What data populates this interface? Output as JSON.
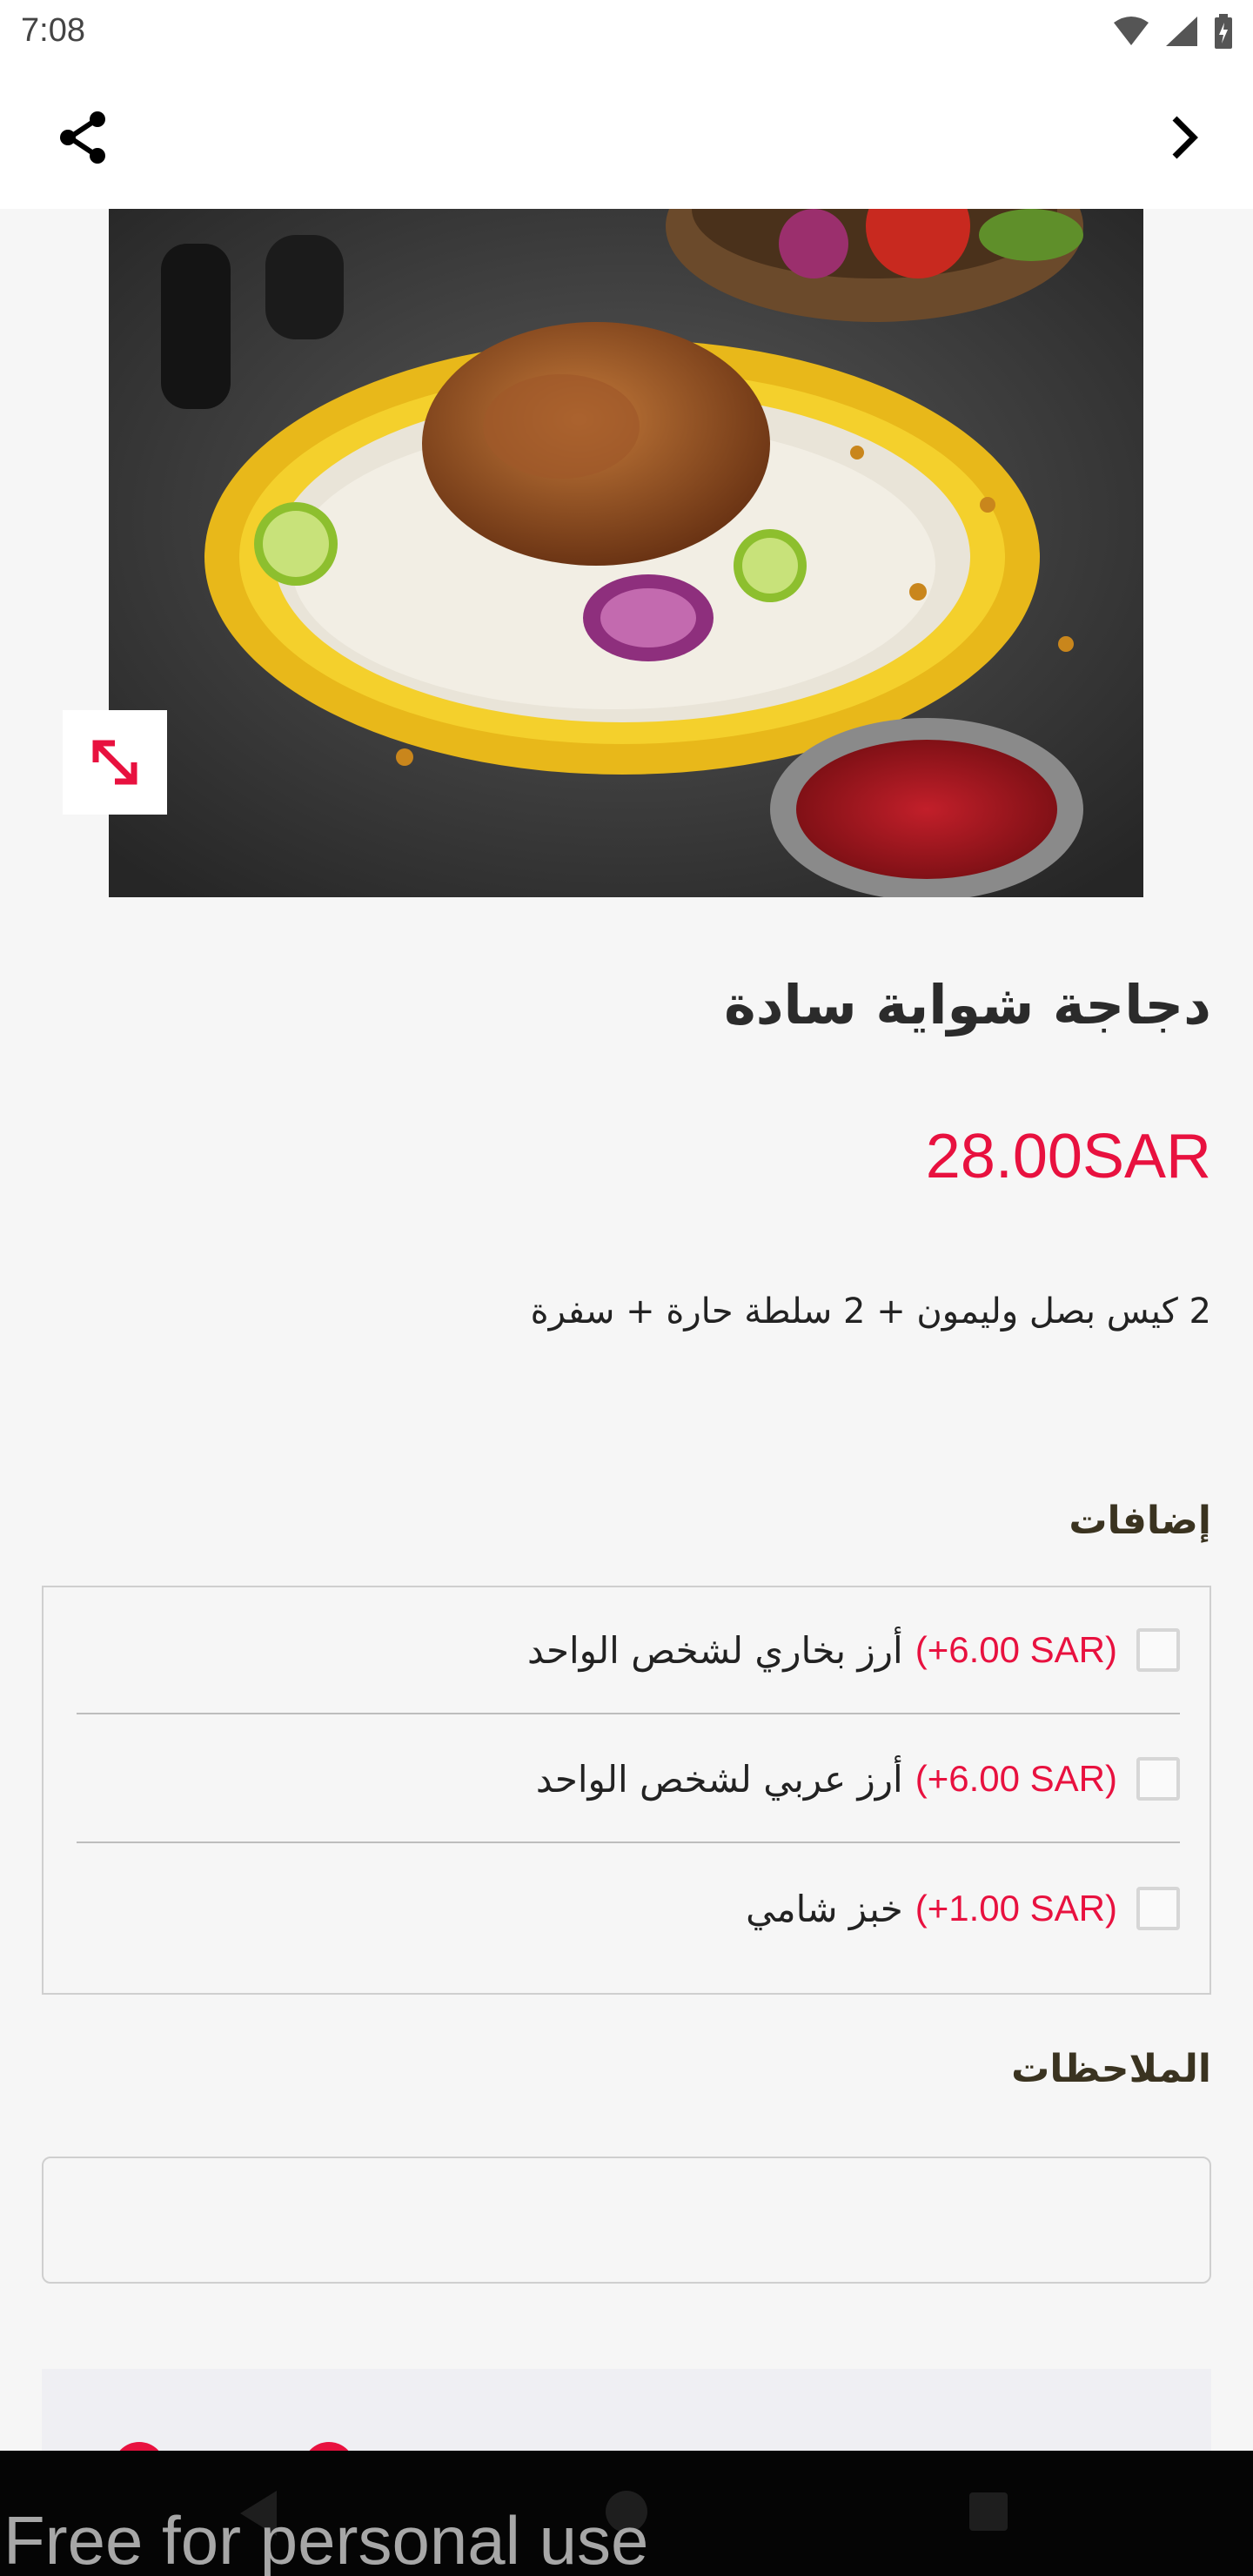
{
  "status_bar": {
    "time": "7:08",
    "icons": [
      "wifi-icon",
      "signal-icon",
      "battery-icon"
    ]
  },
  "app_bar": {
    "share_icon": "share-icon",
    "back_icon": "chevron-right-icon"
  },
  "product": {
    "image_alt": "roast chicken on rice",
    "expand_icon": "expand-icon",
    "title": "دجاجة شواية سادة",
    "price": "28.00SAR",
    "description": "2 كيس بصل وليمون + 2 سلطة حارة + سفرة"
  },
  "addons": {
    "title": "إضافات",
    "items": [
      {
        "name": "أرز بخاري لشخص الواحد",
        "price": "(+6.00 SAR)",
        "checked": false
      },
      {
        "name": "أرز عربي لشخص الواحد",
        "price": "(+6.00 SAR)",
        "checked": false
      },
      {
        "name": "خبز شامي",
        "price": "(+1.00 SAR)",
        "checked": false
      }
    ]
  },
  "notes": {
    "title": "الملاحظات",
    "value": "",
    "placeholder": ""
  },
  "nav": {
    "back_icon": "nav-back-icon",
    "home_icon": "nav-home-icon",
    "recent_icon": "nav-recent-icon"
  },
  "watermark": "Free for personal use",
  "colors": {
    "accent": "#e8113f",
    "background": "#f6f6f6"
  }
}
